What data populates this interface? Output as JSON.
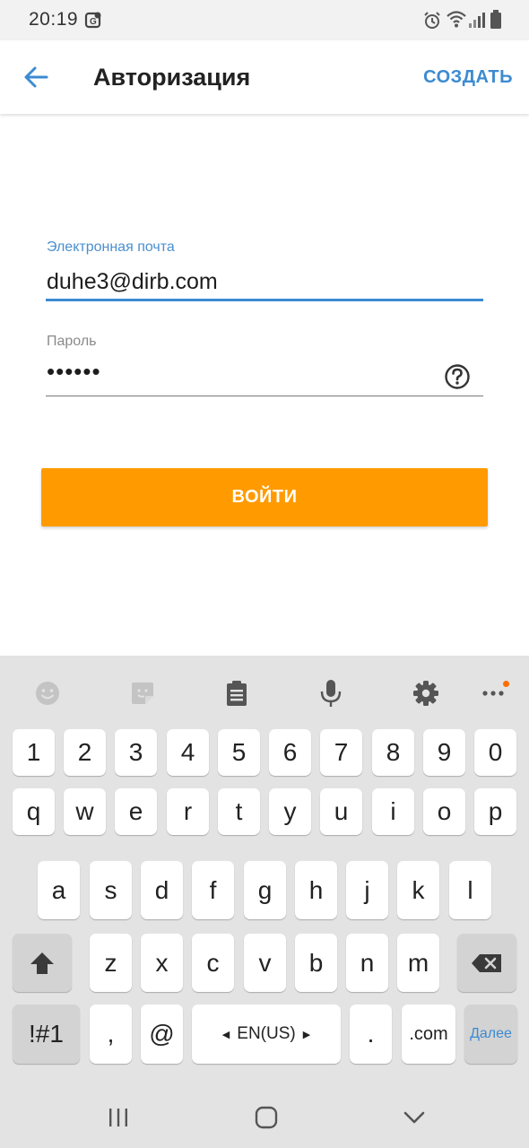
{
  "status_bar": {
    "time": "20:19"
  },
  "app_bar": {
    "title": "Авторизация",
    "create_label": "СОЗДАТЬ"
  },
  "form": {
    "email_label": "Электронная почта",
    "email_value": "duhe3@dirb.com",
    "password_label": "Пароль",
    "password_value": "••••••",
    "login_label": "ВОЙТИ"
  },
  "keyboard": {
    "toolbar": [
      "emoji-icon",
      "sticker-icon",
      "clipboard-icon",
      "microphone-icon",
      "gear-icon",
      "more-icon"
    ],
    "row_numbers": [
      "1",
      "2",
      "3",
      "4",
      "5",
      "6",
      "7",
      "8",
      "9",
      "0"
    ],
    "row1": [
      "q",
      "w",
      "e",
      "r",
      "t",
      "y",
      "u",
      "i",
      "o",
      "p"
    ],
    "row2": [
      "a",
      "s",
      "d",
      "f",
      "g",
      "h",
      "j",
      "k",
      "l"
    ],
    "row3": [
      "z",
      "x",
      "c",
      "v",
      "b",
      "n",
      "m"
    ],
    "bottom": {
      "symbols": "!#1",
      "comma": ",",
      "at": "@",
      "language": "EN(US)",
      "period": ".",
      "dotcom": ".com",
      "next": "Далее"
    }
  },
  "nav_bar": [
    "recents-icon",
    "home-icon",
    "back-chevron-icon"
  ],
  "colors": {
    "accent_blue": "#3c8bd1",
    "login_orange": "#ff9b00",
    "notification_dot": "#ff6d00"
  }
}
